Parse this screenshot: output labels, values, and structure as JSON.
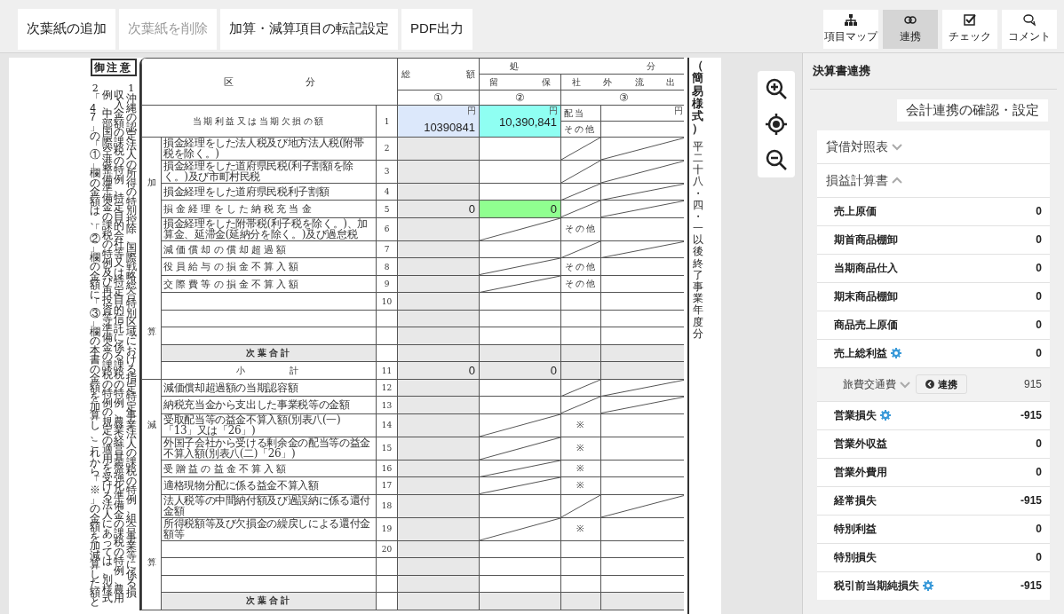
{
  "toolbar": {
    "buttons": [
      {
        "label": "次葉紙の追加",
        "disabled": false
      },
      {
        "label": "次葉紙を削除",
        "disabled": true
      },
      {
        "label": "加算・減算項目の転記設定",
        "disabled": false
      },
      {
        "label": "PDF出力",
        "disabled": false
      }
    ],
    "tools": [
      {
        "kind": "map",
        "label": "項目マップ",
        "selected": false
      },
      {
        "kind": "link",
        "label": "連携",
        "selected": true
      },
      {
        "kind": "check",
        "label": "チェック",
        "selected": false
      },
      {
        "kind": "comment",
        "label": "コメント",
        "selected": false
      }
    ]
  },
  "form": {
    "notes_title": "御注意",
    "note_1": {
      "no": "1",
      "line_1": "沖縄の認定法人の所得の特別控除、国際戦略総合特別区域における指定特定事業法人の課税の特例、組合事業等に係る損",
      "line_2": "収入金額の課税の特例、特定目的会社等又は特定目的信託に係る課税の特例、農業経営基盤強化準備金の課税の特例、農用",
      "line_3": "例、中部国際空港整備準備金の課税の特例及び再投資等準備金の課税の特例の規定の適用を受ける法人にあっては、別様式"
    },
    "note_2": {
      "no": "2",
      "line_1": "「47」の「①」欄の金額は、「②」欄の金額に「③」欄の本書の金額を加算し、これから「※」の金額を加減算した額と"
    },
    "header": {
      "category": "区 分",
      "total": "総 額",
      "disposal": "処 分",
      "retained": "留 保",
      "outflow": "社 外 流 出",
      "col_1": "①",
      "col_2": "②",
      "col_3": "③"
    },
    "profit_row": {
      "label": "当期利益又は当期欠損の額",
      "no": "1",
      "total": {
        "value": "10390841",
        "unit": "円",
        "color": "#dce8fb"
      },
      "retained": {
        "value": "10,390,841",
        "unit": "円",
        "color": "#8ffff2"
      },
      "outflow": [
        {
          "label": "配当",
          "unit": "円"
        },
        {
          "label": "その他"
        }
      ]
    },
    "groups": [
      {
        "labels": [
          "加",
          "算"
        ],
        "rows": [
          {
            "kind": "item",
            "no": "2",
            "label": "損金経理をした法人税及び地方法人税(附帯税を除く。)",
            "retained_struck": false,
            "outflow_struck": true
          },
          {
            "kind": "item",
            "no": "3",
            "label": "損金経理をした道府県民税(利子割額を除く。)及び市町村民税",
            "retained_struck": false,
            "outflow_struck": true
          },
          {
            "kind": "item",
            "no": "4",
            "label": "損金経理をした道府県民税利子割額",
            "retained_struck": false,
            "outflow_struck": true
          },
          {
            "kind": "item",
            "no": "5",
            "label": "損金経理をした納税充当金",
            "total": {
              "value": "0"
            },
            "retained": {
              "value": "0",
              "color": "#90ff90"
            },
            "retained_struck": false,
            "outflow_struck": true
          },
          {
            "kind": "item",
            "no": "6",
            "label": "損金経理をした附帯税(利子税を除く。)、加算金、延滞金(延納分を除く。)及び過怠税",
            "retained_struck": true,
            "dividend": "その他",
            "outflow_struck": false
          },
          {
            "kind": "item",
            "no": "7",
            "label": "減価償却の償却超過額",
            "retained_struck": false,
            "outflow_struck": true
          },
          {
            "kind": "item",
            "no": "8",
            "label": "役員給与の損金不算入額",
            "retained_struck": true,
            "dividend": "その他",
            "outflow_struck": false
          },
          {
            "kind": "item",
            "no": "9",
            "label": "交際費等の損金不算入額",
            "retained_struck": true,
            "dividend": "その他",
            "outflow_struck": false
          },
          {
            "kind": "item",
            "no": "10",
            "retained_struck": false,
            "outflow_struck": false
          },
          {
            "kind": "item",
            "retained_struck": false,
            "outflow_struck": false
          },
          {
            "kind": "item",
            "retained_struck": false,
            "outflow_struck": false
          },
          {
            "kind": "carry",
            "label": "次葉合計"
          },
          {
            "kind": "subtotal",
            "label": "小 計",
            "no": "11",
            "total": {
              "value": "0"
            },
            "retained": {
              "value": "0"
            }
          }
        ]
      },
      {
        "labels": [
          "減",
          "算"
        ],
        "rows": [
          {
            "kind": "item",
            "no": "12",
            "label": "減価償却超過額の当期認容額",
            "retained_struck": false,
            "outflow_struck": true
          },
          {
            "kind": "item",
            "no": "13",
            "label": "納税充当金から支出した事業税等の金額",
            "retained_struck": false,
            "outflow_struck": true
          },
          {
            "kind": "item",
            "no": "14",
            "label": "受取配当等の益金不算入額(別表八(一)「13」又は「26」)",
            "retained_struck": true,
            "dividend": "※",
            "outflow_struck": false
          },
          {
            "kind": "item",
            "no": "15",
            "label": "外国子会社から受ける剰余金の配当等の益金不算入額(別表八(二)「26」)",
            "retained_struck": true,
            "dividend": "※",
            "outflow_struck": false
          },
          {
            "kind": "item",
            "no": "16",
            "label": "受贈益の益金不算入額",
            "retained_struck": true,
            "dividend": "※",
            "outflow_struck": false
          },
          {
            "kind": "item",
            "no": "17",
            "label": "適格現物分配に係る益金不算入額",
            "retained_struck": true,
            "dividend": "※",
            "outflow_struck": false
          },
          {
            "kind": "item",
            "no": "18",
            "label": "法人税等の中間納付額及び過誤納に係る還付金額",
            "retained_struck": false,
            "outflow_struck": true
          },
          {
            "kind": "item",
            "no": "19",
            "label": "所得税額等及び欠損金の繰戻しによる還付金額等",
            "retained_struck": true,
            "dividend": "※",
            "outflow_struck": false
          },
          {
            "kind": "item",
            "no": "20",
            "retained_struck": false,
            "outflow_struck": false
          },
          {
            "kind": "item",
            "retained_struck": false,
            "outflow_struck": false
          },
          {
            "kind": "item",
            "retained_struck": false,
            "outflow_struck": false
          },
          {
            "kind": "carry",
            "label": "次葉合計"
          }
        ]
      }
    ],
    "side_title": "（簡易様式）",
    "side_note": "平二十八・四・一以後終了事業年度分"
  },
  "panel": {
    "title": "決算書連携",
    "settings_button": "会計連携の確認・設定",
    "items": [
      {
        "kind": "section",
        "label": "貸借対照表",
        "expanded": false
      },
      {
        "kind": "section",
        "label": "損益計算書",
        "expanded": true
      },
      {
        "kind": "item",
        "label": "売上原価",
        "value": "0",
        "gear": false
      },
      {
        "kind": "item",
        "label": "期首商品棚卸",
        "value": "0",
        "gear": false
      },
      {
        "kind": "item",
        "label": "当期商品仕入",
        "value": "0",
        "gear": false
      },
      {
        "kind": "item",
        "label": "期末商品棚卸",
        "value": "0",
        "gear": false
      },
      {
        "kind": "item",
        "label": "商品売上原価",
        "value": "0",
        "gear": false
      },
      {
        "kind": "item",
        "label": "売上総利益",
        "value": "0",
        "gear": true
      },
      {
        "kind": "account",
        "label": "旅費交通費",
        "expanded": false,
        "button": "連携",
        "value": "915"
      },
      {
        "kind": "item",
        "label": "営業損失",
        "value": "-915",
        "gear": true
      },
      {
        "kind": "item",
        "label": "営業外収益",
        "value": "0",
        "gear": false
      },
      {
        "kind": "item",
        "label": "営業外費用",
        "value": "0",
        "gear": false
      },
      {
        "kind": "item",
        "label": "経常損失",
        "value": "-915",
        "gear": false
      },
      {
        "kind": "item",
        "label": "特別利益",
        "value": "0",
        "gear": false
      },
      {
        "kind": "item",
        "label": "特別損失",
        "value": "0",
        "gear": false
      },
      {
        "kind": "item",
        "label": "税引前当期純損失",
        "value": "-915",
        "gear": true
      }
    ]
  }
}
